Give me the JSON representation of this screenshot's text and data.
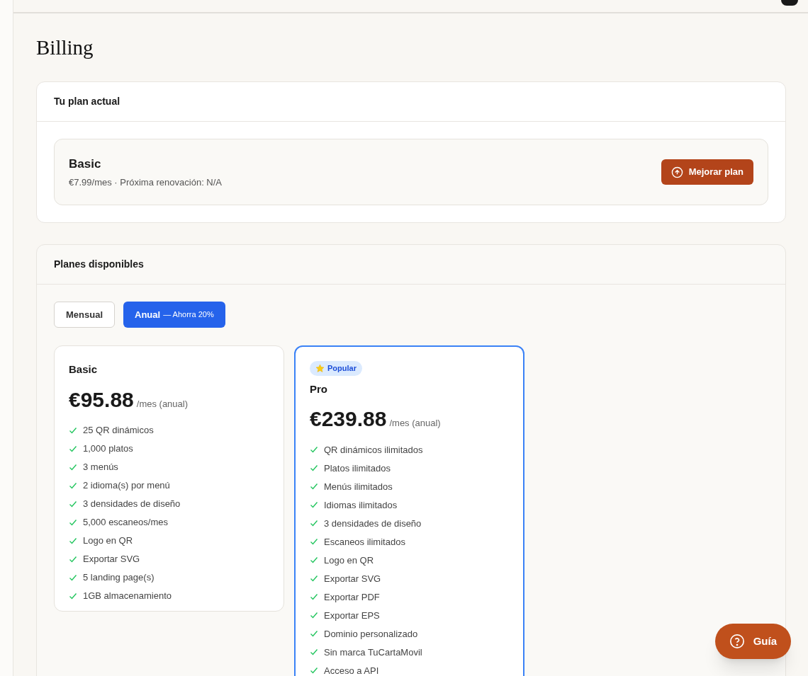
{
  "page": {
    "title": "Billing"
  },
  "current_plan": {
    "title": "Tu plan actual",
    "plan_name": "Basic",
    "details": "€7.99/mes · Próxima renovación: N/A",
    "upgrade_button": "Mejorar plan"
  },
  "available_plans": {
    "title": "Planes disponibles",
    "billing_options": [
      {
        "label": "Mensual",
        "selected": false
      },
      {
        "label": "Anual",
        "note": "— Ahorra 20%",
        "selected": true
      }
    ],
    "plans": [
      {
        "name": "Basic",
        "price": "€95.88",
        "period": "/mes (anual)",
        "selected": false,
        "features": [
          "25 QR dinámicos",
          "1,000 platos",
          "3 menús",
          "2 idioma(s) por menú",
          "3 densidades de diseño",
          "5,000 escaneos/mes",
          "Logo en QR",
          "Exportar SVG",
          "5 landing page(s)",
          "1GB almacenamiento"
        ]
      },
      {
        "name": "Pro",
        "badge": "Popular",
        "price": "€239.88",
        "period": "/mes (anual)",
        "selected": true,
        "features": [
          "QR dinámicos ilimitados",
          "Platos ilimitados",
          "Menús ilimitados",
          "Idiomas ilimitados",
          "3 densidades de diseño",
          "Escaneos ilimitados",
          "Logo en QR",
          "Exportar SVG",
          "Exportar PDF",
          "Exportar EPS",
          "Dominio personalizado",
          "Sin marca TuCartaMovil",
          "Acceso a API"
        ]
      }
    ]
  },
  "guide_button": "Guía"
}
